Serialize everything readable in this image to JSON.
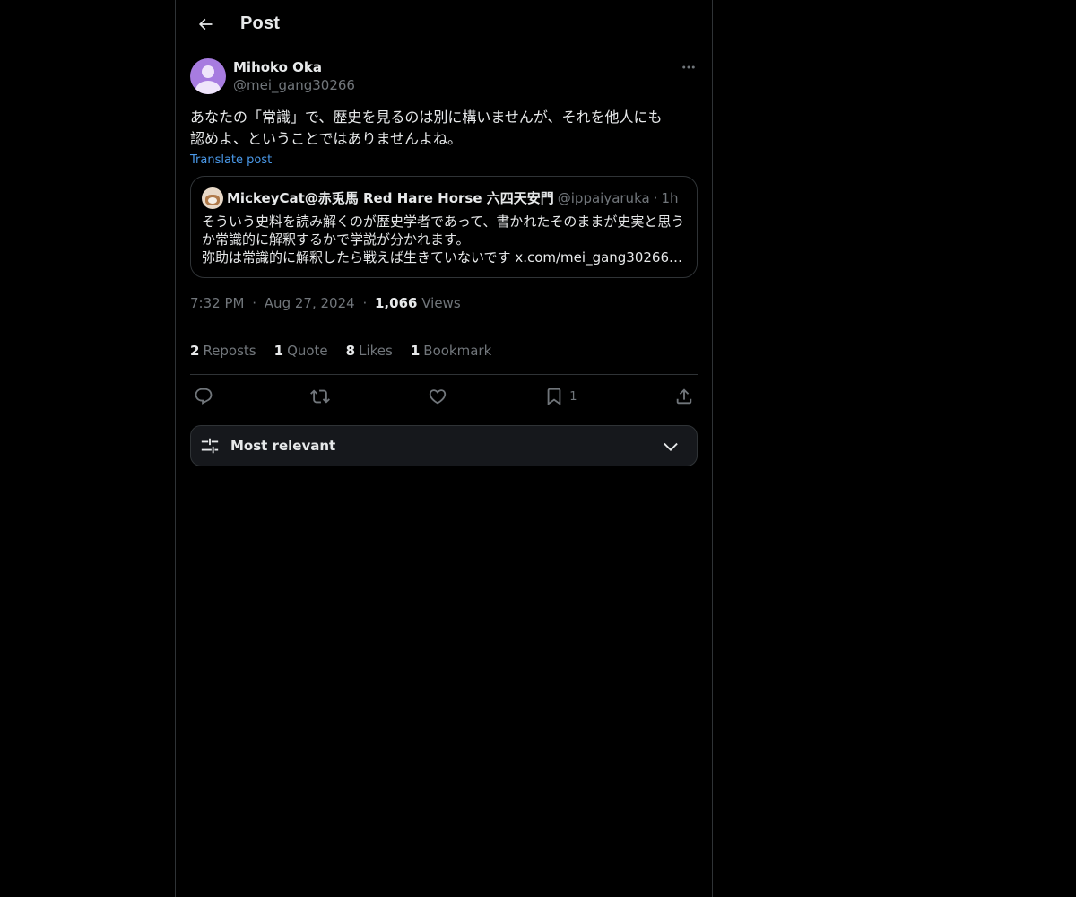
{
  "header": {
    "title": "Post",
    "back_icon": "arrow-left-icon"
  },
  "post": {
    "author_name": "Mihoko Oka",
    "author_handle": "@mei_gang30266",
    "text": "あなたの「常識」で、歴史を見るのは別に構いませんが、それを他人にも\n認めよ、ということではありませんよね。",
    "translate_label": "Translate post",
    "quote": {
      "name": "MickeyCat@赤兎馬 Red Hare Horse 六四天安門",
      "handle": "@ippaiyaruka",
      "separator": "·",
      "time": "1h",
      "lines": [
        "そういう史料を読み解くのが歴史学者であって、書かれたそのままが史実と思う",
        "か常識的に解釈するかで学説が分かれます。",
        "弥助は常識的に解釈したら戦えば生きていないです x.com/mei_gang30266/…"
      ]
    },
    "time": "7:32 PM",
    "date": "Aug 27, 2024",
    "separator": "·",
    "views_count": "1,066",
    "views_label": "Views"
  },
  "stats": [
    {
      "count": "2",
      "label": "Reposts"
    },
    {
      "count": "1",
      "label": "Quote"
    },
    {
      "count": "8",
      "label": "Likes"
    },
    {
      "count": "1",
      "label": "Bookmark"
    }
  ],
  "actions": {
    "reply_icon": "reply-icon",
    "repost_icon": "repost-icon",
    "like_icon": "heart-icon",
    "bookmark_icon": "bookmark-icon",
    "bookmark_count": "1",
    "share_icon": "share-icon"
  },
  "filter": {
    "label": "Most relevant"
  },
  "colors": {
    "background": "#000000",
    "border": "#2f3336",
    "link": "#1d9bf0",
    "muted": "#71767b",
    "text": "#e7e9ea"
  }
}
